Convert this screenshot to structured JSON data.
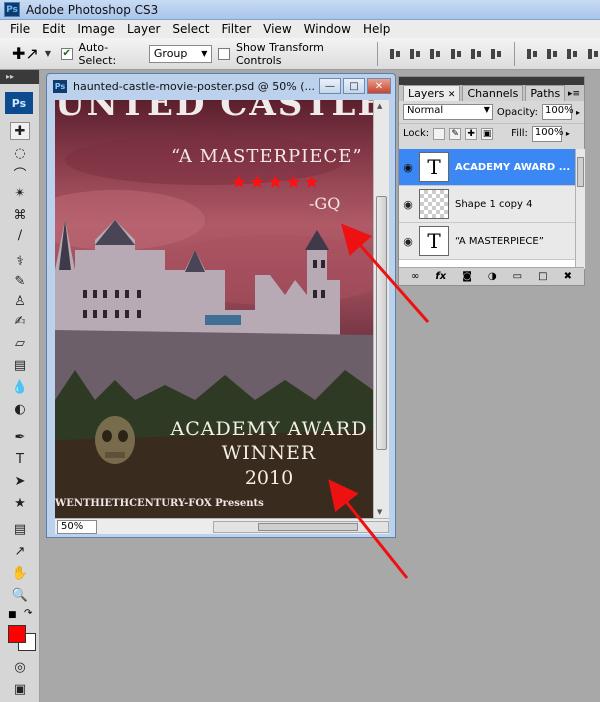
{
  "app": {
    "badge": "Ps",
    "title": "Adobe Photoshop CS3"
  },
  "menu": [
    "File",
    "Edit",
    "Image",
    "Layer",
    "Select",
    "Filter",
    "View",
    "Window",
    "Help"
  ],
  "options": {
    "auto_select_label": "Auto-Select:",
    "auto_select_checked": true,
    "auto_select_value": "Group",
    "show_transform_label": "Show Transform Controls",
    "show_transform_checked": false
  },
  "tools": {
    "logo": "Ps",
    "foreground_color": "#ff0000",
    "background_color": "#ffffff"
  },
  "document": {
    "badge": "Ps",
    "title": "haunted-castle-movie-poster.psd @ 50% (...",
    "zoom": "50%",
    "buttons": {
      "minimize": "—",
      "maximize": "□",
      "close": "✕"
    },
    "poster": {
      "title_partial": "UNTED CASTLE",
      "quote": "“A MASTERPIECE”",
      "stars": "★★★★★",
      "source": "-GQ",
      "award_line1": "ACADEMY AWARD",
      "award_line2": "WINNER",
      "award_line3": "2010",
      "credits": "WENTHIETHCENTURY-FOX Presents"
    }
  },
  "layers_panel": {
    "tabs": [
      "Layers",
      "Channels",
      "Paths"
    ],
    "active_tab": "Layers",
    "blend_mode": "Normal",
    "opacity_label": "Opacity:",
    "opacity_value": "100%",
    "lock_label": "Lock:",
    "fill_label": "Fill:",
    "fill_value": "100%",
    "layers": [
      {
        "name": "ACADEMY AWARD ...",
        "type": "text",
        "selected": true,
        "visible": true
      },
      {
        "name": "Shape 1 copy 4",
        "type": "shape",
        "selected": false,
        "visible": true
      },
      {
        "name": "“A MASTERPIECE”",
        "type": "text",
        "selected": false,
        "visible": true
      }
    ],
    "footer_icons": [
      "link-icon",
      "fx-icon",
      "mask-icon",
      "adjustment-icon",
      "group-icon",
      "new-layer-icon",
      "trash-icon"
    ]
  },
  "annotation_color": "#ee1111"
}
